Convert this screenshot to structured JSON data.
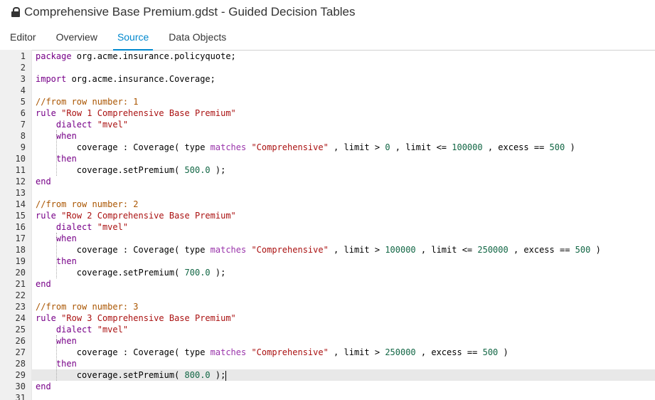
{
  "window": {
    "title": "Comprehensive Base Premium.gdst - Guided Decision Tables"
  },
  "tabs": [
    {
      "label": "Editor",
      "active": false
    },
    {
      "label": "Overview",
      "active": false
    },
    {
      "label": "Source",
      "active": true
    },
    {
      "label": "Data Objects",
      "active": false
    }
  ],
  "code": [
    "package org.acme.insurance.policyquote;",
    "",
    "import org.acme.insurance.Coverage;",
    "",
    "//from row number: 1",
    "rule \"Row 1 Comprehensive Base Premium\"",
    "    dialect \"mvel\"",
    "    when",
    "        coverage : Coverage( type matches \"Comprehensive\" , limit > 0 , limit <= 100000 , excess == 500 )",
    "    then",
    "        coverage.setPremium( 500.0 );",
    "end",
    "",
    "//from row number: 2",
    "rule \"Row 2 Comprehensive Base Premium\"",
    "    dialect \"mvel\"",
    "    when",
    "        coverage : Coverage( type matches \"Comprehensive\" , limit > 100000 , limit <= 250000 , excess == 500 )",
    "    then",
    "        coverage.setPremium( 700.0 );",
    "end",
    "",
    "//from row number: 3",
    "rule \"Row 3 Comprehensive Base Premium\"",
    "    dialect \"mvel\"",
    "    when",
    "        coverage : Coverage( type matches \"Comprehensive\" , limit > 250000 , excess == 500 )",
    "    then",
    "        coverage.setPremium( 800.0 );",
    "end",
    ""
  ],
  "editor": {
    "active_line": 29
  }
}
